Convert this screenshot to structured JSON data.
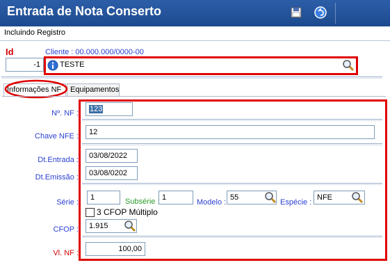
{
  "window": {
    "title": "Entrada de Nota Conserto"
  },
  "toolbar": {
    "save_icon": "floppy-disk-icon",
    "back_icon": "undo-arrow-icon"
  },
  "subtab": {
    "label": "Incluindo Registro"
  },
  "header": {
    "id_label": "Id",
    "id_value": "-1",
    "cliente_label": "Cliente : 00.000.000/0000-00",
    "cliente_value": "TESTE"
  },
  "tabs": [
    {
      "label": "Informações NF"
    },
    {
      "label": "Equipamentos"
    }
  ],
  "form": {
    "nf_label": "Nº. NF :",
    "nf_value": "123",
    "chave_label": "Chave NFE :",
    "chave_value": "12",
    "dt_entrada_label": "Dt.Entrada :",
    "dt_entrada_value": "03/08/2022",
    "dt_emissao_label": "Dt.Emissão :",
    "dt_emissao_value": "03/08/0202",
    "serie_label": "Série :",
    "serie_value": "1",
    "subserie_label": "Subsérie :",
    "subserie_value": "1",
    "modelo_label": "Modelo :",
    "modelo_value": "55",
    "especie_label": "Espécie :",
    "especie_value": "NFE",
    "cfop_multiplo_label": "3 CFOP Múltiplo",
    "cfop_label": "CFOP :",
    "cfop_value": "1.915",
    "vl_nf_label": "Vl. NF :",
    "vl_nf_value": "100,00"
  },
  "colors": {
    "title_bar": "#1d4a8e",
    "highlight": "#e00000",
    "label_blue": "#2a3fd0",
    "label_red": "#d40000"
  }
}
